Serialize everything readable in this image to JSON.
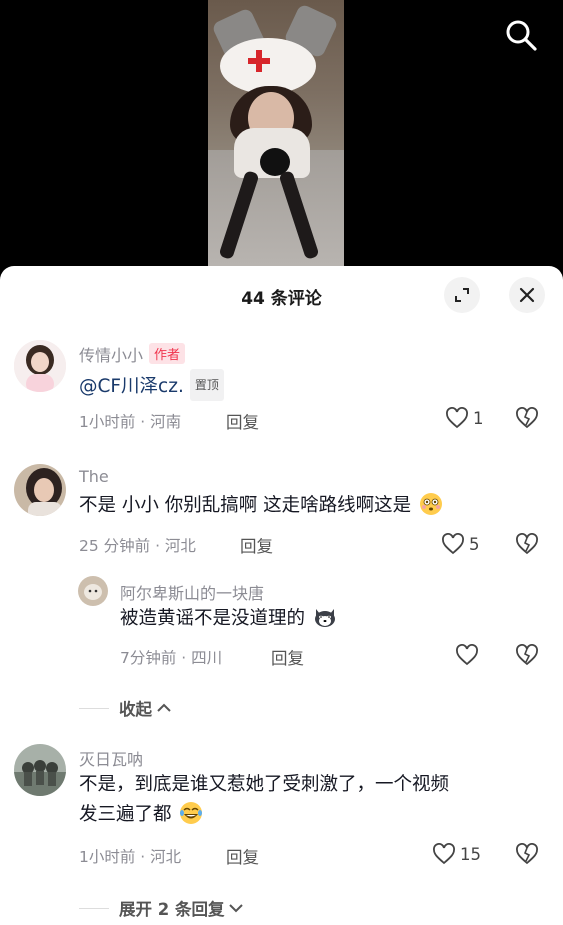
{
  "sheet": {
    "title": "44 条评论"
  },
  "comments": [
    {
      "name": "传情小小",
      "author_badge": "作者",
      "mention": "@CF川泽cz.",
      "pin_badge": "置顶",
      "meta": "1小时前 · 河南",
      "reply_label": "回复",
      "likes": "1"
    },
    {
      "name": "The",
      "text": "不是  小小 你别乱搞啊  这走啥路线啊这是",
      "meta": "25 分钟前 · 河北",
      "reply_label": "回复",
      "likes": "5"
    },
    {
      "name": "阿尔卑斯山的一块唐",
      "text": "被造黄谣不是没道理的",
      "meta": "7分钟前 · 四川",
      "reply_label": "回复",
      "likes": ""
    },
    {
      "name": "灭日瓦呐",
      "text_line1": "不是，到底是谁又惹她了受刺激了，一个视频",
      "text_line2": "发三遍了都",
      "meta": "1小时前 · 河北",
      "reply_label": "回复",
      "likes": "15"
    }
  ],
  "collapse_label": "收起",
  "expand_label": "展开 2 条回复",
  "colors": {
    "author_badge": "#f0364f",
    "mention": "#1a3a6b"
  },
  "icons": [
    "search-icon",
    "expand-icon",
    "close-icon",
    "heart-icon",
    "dislike-heart-icon",
    "chevron-up-icon",
    "chevron-down-icon"
  ]
}
